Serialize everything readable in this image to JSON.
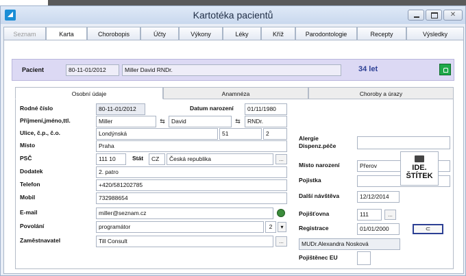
{
  "window": {
    "title": "Kartotéka pacientů"
  },
  "main_tabs": [
    {
      "label": "Seznam",
      "disabled": true
    },
    {
      "label": "Karta",
      "active": true
    },
    {
      "label": "Chorobopis"
    },
    {
      "label": "Účty"
    },
    {
      "label": "Výkony"
    },
    {
      "label": "Léky"
    },
    {
      "label": "Kříž"
    },
    {
      "label": "Parodontologie"
    },
    {
      "label": "Recepty"
    },
    {
      "label": "Výsledky"
    }
  ],
  "patient": {
    "label": "Pacient",
    "birth_number": "80-11-01/2012",
    "name": "Miller David RNDr.",
    "age": "34 let"
  },
  "sub_tabs": [
    {
      "label": "Osobní údaje"
    },
    {
      "label": "Anamnéza"
    },
    {
      "label": "Choroby a úrazy"
    }
  ],
  "form": {
    "rodne_cislo": {
      "label": "Rodné číslo",
      "value": "80-11-01/2012"
    },
    "datum_narozeni": {
      "label": "Datum narození",
      "value": "01/11/1980"
    },
    "prijmeni": {
      "label": "Příjmení,jméno,ttl.",
      "surname": "Miller",
      "first": "David",
      "title": "RNDr.",
      "swap": "⇆"
    },
    "ulice": {
      "label": "Ulice, č.p., č.o.",
      "street": "Londýnská",
      "cp": "51",
      "co": "2"
    },
    "misto": {
      "label": "Místo",
      "value": "Praha"
    },
    "psc": {
      "label": "PSČ",
      "value": "111 10",
      "stat_label": "Stát",
      "stat_code": "CZ",
      "stat_name": "Česká republika"
    },
    "dodatek": {
      "label": "Dodatek",
      "value": "2. patro"
    },
    "telefon": {
      "label": "Telefon",
      "value": "+420/581202785"
    },
    "mobil": {
      "label": "Mobil",
      "value": "732988654"
    },
    "email": {
      "label": "E-mail",
      "value": "miller@seznam.cz"
    },
    "povolani": {
      "label": "Povolání",
      "value": "programátor",
      "code": "2"
    },
    "zamestnavatel": {
      "label": "Zaměstnavatel",
      "value": "Till Consult"
    },
    "alergie": {
      "label": "Alergie\nDispenz.péče",
      "value": ""
    },
    "misto_narozeni": {
      "label": "Místo narození",
      "value": "Přerov"
    },
    "pojistka": {
      "label": "Pojistka",
      "value": ""
    },
    "dalsi_navsteva": {
      "label": "Další návštěva",
      "value": "12/12/2014"
    },
    "pojistovna": {
      "label": "Pojišťovna",
      "value": "111"
    },
    "registrace": {
      "label": "Registrace",
      "value": "01/01/2000"
    },
    "lekar": {
      "value": "MUDr.Alexandra Nosková"
    },
    "pojistenec_eu": {
      "label": "Pojištěnec EU"
    },
    "print_button": {
      "label": "IDE.\nŠTÍTEK"
    },
    "ellipsis": "...",
    "chevron": "▾",
    "select_icon": "⊂"
  },
  "colors": {
    "patient_bar": "#dcd9f4",
    "age": "#2c3f94",
    "lock": "#1fa84a"
  },
  "icons": [
    "app-icon",
    "minimize-icon",
    "maximize-icon",
    "close-icon",
    "lock-icon",
    "swap-icon",
    "globe-icon",
    "chevron-down-icon",
    "printer-icon"
  ]
}
